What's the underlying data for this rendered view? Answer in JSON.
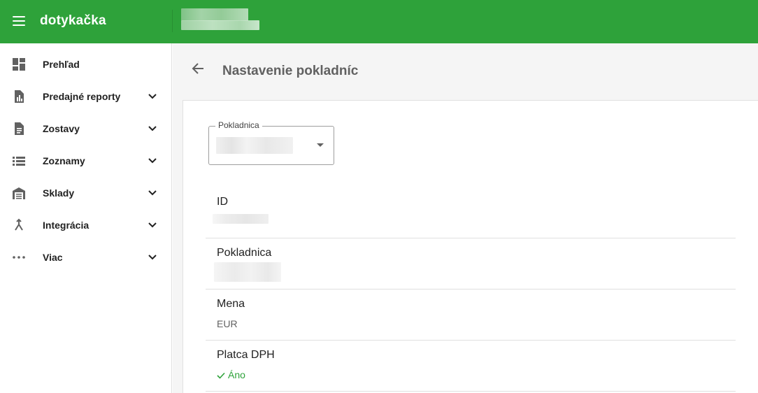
{
  "app": {
    "logo_text": "dotykačka"
  },
  "sidebar": {
    "items": [
      {
        "label": "Prehľad",
        "icon": "dashboard-icon",
        "has_submenu": false
      },
      {
        "label": "Predajné reporty",
        "icon": "report-icon",
        "has_submenu": true
      },
      {
        "label": "Zostavy",
        "icon": "document-icon",
        "has_submenu": true
      },
      {
        "label": "Zoznamy",
        "icon": "list-icon",
        "has_submenu": true
      },
      {
        "label": "Sklady",
        "icon": "warehouse-icon",
        "has_submenu": true
      },
      {
        "label": "Integrácia",
        "icon": "merge-icon",
        "has_submenu": true
      },
      {
        "label": "Viac",
        "icon": "more-horiz-icon",
        "has_submenu": true
      }
    ]
  },
  "main": {
    "title": "Nastavenie pokladníc",
    "select": {
      "label": "Pokladnica"
    },
    "fields": [
      {
        "label": "ID"
      },
      {
        "label": "Pokladnica"
      },
      {
        "label": "Mena",
        "value": "EUR"
      },
      {
        "label": "Platca DPH",
        "value": "Áno"
      }
    ]
  },
  "colors": {
    "brand_green": "#2ea23a",
    "sidebar_border": "#e0e0e0",
    "main_bg": "#f5f5f5"
  }
}
